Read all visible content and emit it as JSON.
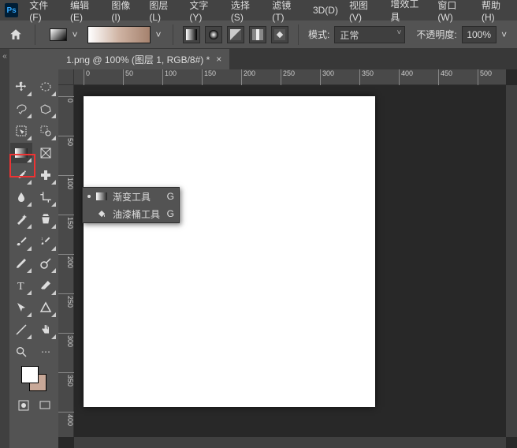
{
  "menubar": {
    "items": [
      "文件(F)",
      "编辑(E)",
      "图像(I)",
      "图层(L)",
      "文字(Y)",
      "选择(S)",
      "滤镜(T)",
      "3D(D)",
      "视图(V)",
      "增效工具",
      "窗口(W)",
      "帮助(H)"
    ]
  },
  "options": {
    "mode_label": "模式:",
    "mode_value": "正常",
    "opacity_label": "不透明度:",
    "opacity_value": "100%"
  },
  "doc_tab": "1.png @ 100% (图层 1, RGB/8#) *",
  "ruler_h": [
    "0",
    "50",
    "100",
    "150",
    "200",
    "250",
    "300",
    "350",
    "400",
    "450",
    "500"
  ],
  "ruler_v": [
    "0",
    "50",
    "100",
    "150",
    "200",
    "250",
    "300",
    "350",
    "400"
  ],
  "flyout": {
    "items": [
      {
        "label": "渐变工具",
        "shortcut": "G",
        "icon": "gradient"
      },
      {
        "label": "油漆桶工具",
        "shortcut": "G",
        "icon": "bucket"
      }
    ]
  },
  "collapse_glyph": "«"
}
